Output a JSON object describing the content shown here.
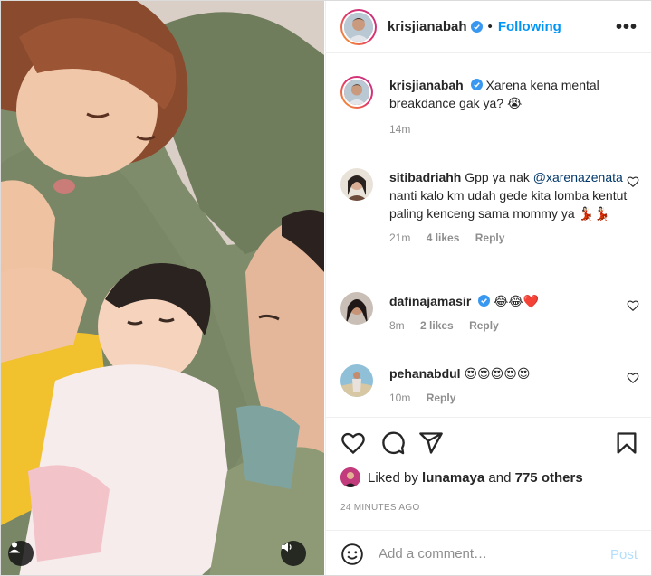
{
  "header": {
    "username": "krisjianabah",
    "separator": "•",
    "follow_label": "Following",
    "more_label": "•••"
  },
  "caption": {
    "username": "krisjianabah",
    "text": "Xarena kena mental breakdance gak ya? 😭",
    "time": "14m"
  },
  "comments": [
    {
      "username": "sitibadriahh",
      "text_before": "Gpp ya nak",
      "mention": "@xarenazenata",
      "text_after": "nanti kalo km udah gede kita lomba kentut paling kenceng sama mommy ya 💃🏻💃🏻",
      "time": "21m",
      "likes": "4 likes",
      "reply": "Reply"
    },
    {
      "username": "dafinajamasir",
      "text": "😂😂❤️",
      "time": "8m",
      "likes": "2 likes",
      "reply": "Reply"
    },
    {
      "username": "pehanabdul",
      "text": "😍😍😍😍😍",
      "time": "10m",
      "reply": "Reply"
    }
  ],
  "liked_by": {
    "prefix": "Liked by",
    "user": "lunamaya",
    "middle": "and",
    "others": "775 others"
  },
  "timestamp": "24 MINUTES AGO",
  "add_comment": {
    "placeholder": "Add a comment…",
    "post_label": "Post"
  },
  "colors": {
    "link_blue": "#0095f6",
    "mention_blue": "#00376b",
    "muted": "#8e8e8e",
    "post_disabled": "#b2dffc"
  }
}
